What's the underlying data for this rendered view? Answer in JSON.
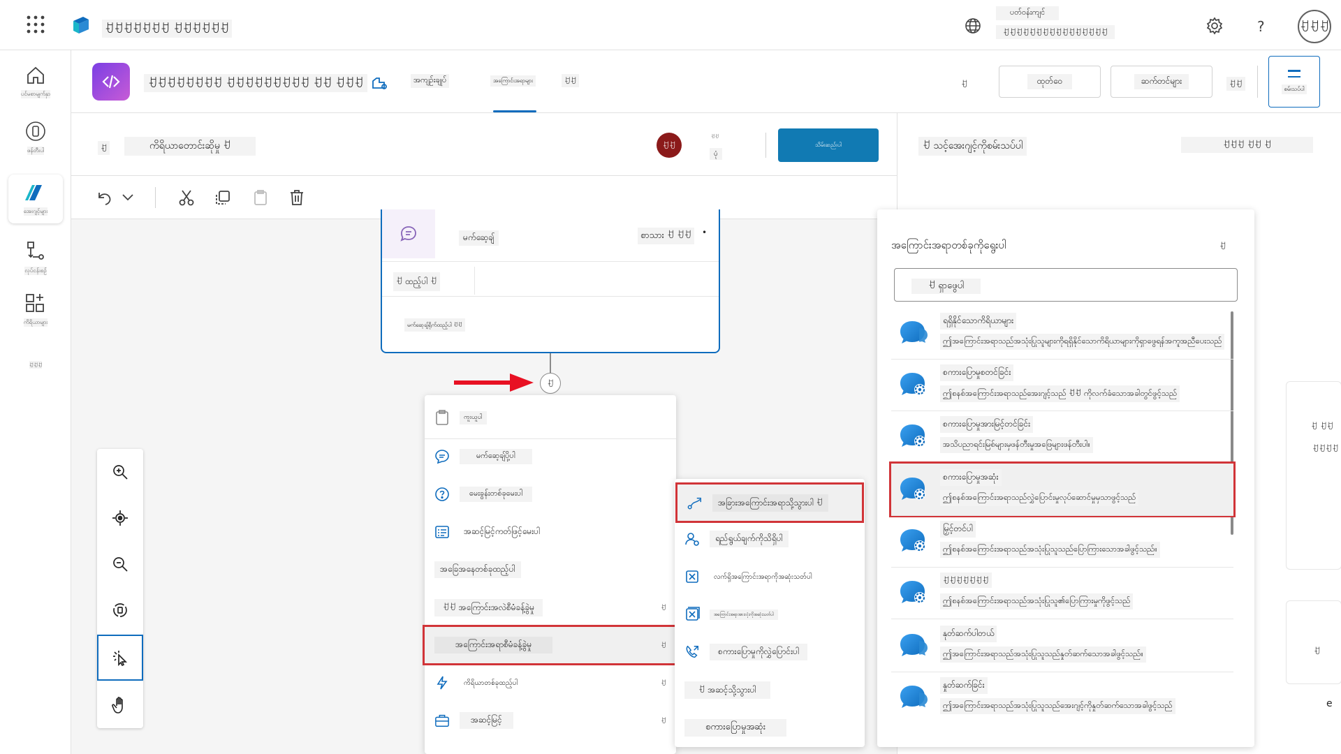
{
  "app": {
    "title": "ꀀꀀꀀꀀꀀꀀꀀ ꀀꀀꀀꀀꀀꀀ",
    "environment_label": "ပတ်ဝန်းကျင်",
    "environment_value": "ꀀꀀꀀꀀꀀꀀꀀꀀꀀꀀꀀꀀꀀꀀꀀꀀ",
    "avatar_initials": "ꀀꀀꀀ",
    "help_label": "?"
  },
  "rail": {
    "items": [
      {
        "label": "ပင်မစာမျက်နှာ",
        "icon": "home-icon"
      },
      {
        "label": "ဖန်တီးပါ",
        "icon": "create-icon"
      },
      {
        "label": "အေးဂျင့်များ",
        "icon": "agents-icon"
      },
      {
        "label": "လုပ်ငန်းစဉ်",
        "icon": "flows-icon"
      },
      {
        "label": "ကိရိယာများ",
        "icon": "tools-icon"
      },
      {
        "label": "ꀀꀀꀀ",
        "icon": "more-icon"
      }
    ]
  },
  "agent": {
    "name": "ꀀꀀꀀꀀꀀꀀꀀꀀ ꀀꀀꀀꀀꀀꀀꀀꀀꀀ ꀀꀀ ꀀꀀꀀ",
    "tabs": [
      "အကျဉ်းချုပ်",
      "အကြောင်းအရာများ",
      "ꀀꀀ"
    ],
    "active_tab": 1,
    "small_btn_1": "ꀀ",
    "btn_publish": "ထုတ်ဝေ",
    "btn_settings": "ဆက်တင်များ",
    "small_btn_2": "ꀀꀀ",
    "test_label": "စမ်းသပ်ပါ"
  },
  "topic": {
    "name": "ကိရိယာတောင်းဆိုမှု ꀀ",
    "back_icon": "ꀀ",
    "user_initials": "ꀀꀀ",
    "status_top": "ꀀꀀ",
    "status_bottom": "ပုံ",
    "save_label": "သိမ်းဆည်းပါ"
  },
  "test_pane": {
    "title": "ꀀ သင့်အေးဂျင့်ကိုစမ်းသပ်ပါ",
    "header_actions": "ꀀꀀꀀ ꀀꀀ ꀀ",
    "peek_1": "ꀀ ꀀꀀ",
    "peek_2": "ꀀꀀꀀꀀ",
    "peek_3": "ꀀ",
    "peek_4": "e"
  },
  "msg_node": {
    "title": "မက်ဆေ့ချ်",
    "type_label": "စာသား ꀀ ꀀꀀ",
    "more": "•",
    "insert_label": "ꀀ ထည့်ပါ ꀀ",
    "placeholder": "မက်ဆေ့ချ်ရိုက်ထည့်ပါ ꀀꀀ"
  },
  "add_node_menu": {
    "paste": "ကူးယူပါ",
    "items": [
      {
        "label": "မက်ဆေ့ချ်ပို့ပါ",
        "icon": "message-icon",
        "chev": ""
      },
      {
        "label": "မေးခွန်းတစ်ခုမေးပါ",
        "icon": "question-icon",
        "chev": ""
      },
      {
        "label": "အဆင့်မြင့်ကတ်ဖြင့်မေးပါ",
        "icon": "card-icon",
        "chev": ""
      },
      {
        "label": "အခြေအနေတစ်ခုထည့်ပါ",
        "icon": "",
        "chev": ""
      },
      {
        "label": "ꀀꀀ အကြောင်းအလဲစီမံခန့်ခွဲမှု",
        "icon": "",
        "chev": "ꀀ"
      },
      {
        "label": "အကြောင်းအရာစီမံခန့်ခွဲမှု",
        "icon": "",
        "chev": "ꀀ"
      },
      {
        "label": "ကိရိယာတစ်ခုထည့်ပါ",
        "icon": "bolt-icon",
        "chev": "ꀀ"
      },
      {
        "label": "အဆင့်မြင့်",
        "icon": "briefcase-icon",
        "chev": "ꀀ"
      }
    ]
  },
  "topic_mgmt_menu": {
    "items": [
      {
        "label": "အခြားအကြောင်းအရာသို့သွားပါ ꀀ",
        "icon": "redirect-icon"
      },
      {
        "label": "ရည်ရွယ်ချက်ကိုသိရှိပါ",
        "icon": "recognize-icon"
      },
      {
        "label": "လက်ရှိအကြောင်းအရာကိုအဆုံးသတ်ပါ",
        "icon": "end-topic-icon"
      },
      {
        "label": "အကြောင်းအရာအားလုံးကိုအဆုံးသတ်ပါ",
        "icon": "end-all-icon"
      },
      {
        "label": "စကားပြောမှုကိုလွှဲပြောင်းပါ",
        "icon": "transfer-icon"
      },
      {
        "label": "ꀀ အဆင့်သို့သွားပါ",
        "icon": ""
      },
      {
        "label": "စကားပြောမှုအဆုံး",
        "icon": ""
      }
    ]
  },
  "topic_picker": {
    "title": "အကြောင်းအရာတစ်ခုကိုရွေးပါ",
    "close": "ꀀ",
    "search_placeholder": "ꀀ ရှာဖွေပါ",
    "items": [
      {
        "title": "ရရှိနိုင်သောကိရိယာများ",
        "desc": "ဤအကြောင်းအရာသည်အသုံးပြုသူများကိုရရှိနိုင်သောကိရိယာများကိုရှာဖွေရန်အကူအညီပေးသည်",
        "icon": "chat-icon"
      },
      {
        "title": "စကားပြောမှုစတင်ခြင်း",
        "desc": "ဤစနစ်အကြောင်းအရာသည်အေးဂျင့်သည် ꀀꀀ ကိုလက်ခံသောအခါတွင်ဖွင့်သည်",
        "icon": "system-chat-icon"
      },
      {
        "title": "စကားပြောမှုအားမြင့်တင်ခြင်း",
        "desc": "အသိပညာရင်းမြစ်များမှဖန်တီးမှုအဖြေများဖန်တီးပါ။",
        "icon": "system-chat-icon"
      },
      {
        "title": "စကားပြောမှုအဆုံး",
        "desc": "ဤစနစ်အကြောင်းအရာသည်လွှဲပြောင်းမှုလုပ်ဆောင်မှုမှသာဖွင့်သည်",
        "icon": "system-chat-icon"
      },
      {
        "title": "မြှင့်တင်ပါ",
        "desc": "ဤစနစ်အကြောင်းအရာသည်အသုံးပြုသူသည်ပြောကြားသောအခါဖွင့်သည်။",
        "icon": "system-chat-icon"
      },
      {
        "title": "ꀀꀀꀀꀀꀀꀀꀀ",
        "desc": "ဤစနစ်အကြောင်းအရာသည်အသုံးပြုသူ၏ပြောကြားမှုကိုဖွင့်သည်",
        "icon": "system-chat-icon"
      },
      {
        "title": "နုတ်ဆက်ပါတယ်",
        "desc": "ဤအကြောင်းအရာသည်အသုံးပြုသူသည်နှုတ်ဆက်သောအခါဖွင့်သည်။",
        "icon": "chat-icon"
      },
      {
        "title": "နှုတ်ဆက်ခြင်း",
        "desc": "ဤအကြောင်းအရာသည်အသုံးပြုသူသည်အေးဂျင့်ကိုနှုတ်ဆက်သောအခါဖွင့်သည်",
        "icon": "chat-icon"
      }
    ]
  },
  "zoom_tools": [
    "zoom-in-icon",
    "focus-icon",
    "zoom-out-icon",
    "minimap-icon",
    "select-icon",
    "pan-icon"
  ],
  "colors": {
    "accent": "#0f6cbd",
    "highlight": "#d13438",
    "node_border": "#0f6cbd",
    "arrow": "#e81123"
  }
}
